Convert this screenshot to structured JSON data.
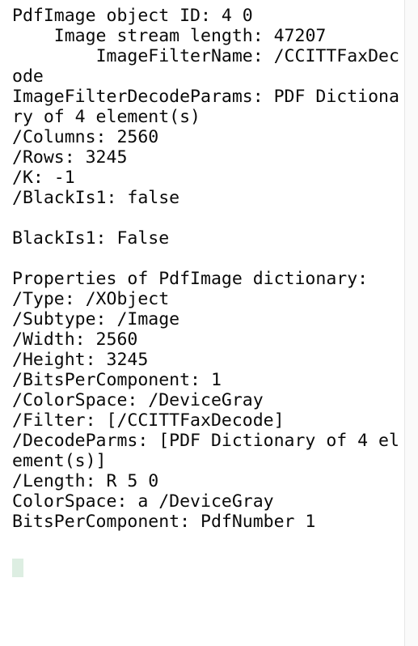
{
  "console": {
    "title": "PdfImage object inspection output",
    "background_color": "#ffffff",
    "text_color": "#0a0a0a",
    "cursor_color": "#ddeee2",
    "gutter_color": "#fafafa",
    "divider_color": "#e6e6e6",
    "font_size_px": 21.5,
    "line_height_px": 25,
    "wrap_columns": 36,
    "output": "PdfImage object ID: 4 0\n    Image stream length: 47207\n        ImageFilterName: /CCITTFaxDecode\nImageFilterDecodeParams: PDF Dictionary of 4 element(s)\n/Columns: 2560\n/Rows: 3245\n/K: -1\n/BlackIs1: false\n\nBlackIs1: False\n\nProperties of PdfImage dictionary:\n/Type: /XObject\n/Subtype: /Image\n/Width: 2560\n/Height: 3245\n/BitsPerComponent: 1\n/ColorSpace: /DeviceGray\n/Filter: [/CCITTFaxDecode]\n/DecodeParms: [PDF Dictionary of 4 element(s)]\n/Length: R 5 0\nColorSpace: a /DeviceGray\nBitsPerComponent: PdfNumber 1\n",
    "lines": [
      {
        "indent": 0,
        "text": "PdfImage object ID: 4 0"
      },
      {
        "indent": 4,
        "text": "Image stream length: 47207"
      },
      {
        "indent": 8,
        "text": "ImageFilterName: /CCITTFaxDecode"
      },
      {
        "indent": 0,
        "text": "ImageFilterDecodeParams: PDF Dictionary of 4 element(s)"
      },
      {
        "indent": 0,
        "text": "/Columns: 2560"
      },
      {
        "indent": 0,
        "text": "/Rows: 3245"
      },
      {
        "indent": 0,
        "text": "/K: -1"
      },
      {
        "indent": 0,
        "text": "/BlackIs1: false"
      },
      {
        "indent": 0,
        "text": ""
      },
      {
        "indent": 0,
        "text": "BlackIs1: False"
      },
      {
        "indent": 0,
        "text": ""
      },
      {
        "indent": 0,
        "text": "Properties of PdfImage dictionary:"
      },
      {
        "indent": 0,
        "text": "/Type: /XObject"
      },
      {
        "indent": 0,
        "text": "/Subtype: /Image"
      },
      {
        "indent": 0,
        "text": "/Width: 2560"
      },
      {
        "indent": 0,
        "text": "/Height: 3245"
      },
      {
        "indent": 0,
        "text": "/BitsPerComponent: 1"
      },
      {
        "indent": 0,
        "text": "/ColorSpace: /DeviceGray"
      },
      {
        "indent": 0,
        "text": "/Filter: [/CCITTFaxDecode]"
      },
      {
        "indent": 0,
        "text": "/DecodeParms: [PDF Dictionary of 4 element(s)]"
      },
      {
        "indent": 0,
        "text": "/Length: R 5 0"
      },
      {
        "indent": 0,
        "text": "ColorSpace: a /DeviceGray"
      },
      {
        "indent": 0,
        "text": "BitsPerComponent: PdfNumber 1"
      }
    ],
    "values": {
      "object_id": "4 0",
      "image_stream_length": "47207",
      "image_filter_name": "/CCITTFaxDecode",
      "image_filter_decode_params": "PDF Dictionary of 4 element(s)",
      "columns": "2560",
      "rows": "3245",
      "k": "-1",
      "black_is_1_param": "false",
      "black_is_1_property": "False",
      "type": "/XObject",
      "subtype": "/Image",
      "width": "2560",
      "height": "3245",
      "bits_per_component": "1",
      "color_space": "/DeviceGray",
      "filter": "[/CCITTFaxDecode]",
      "decode_parms": "[PDF Dictionary of 4 element(s)]",
      "length": "R 5 0",
      "color_space_resolved": "a /DeviceGray",
      "bits_per_component_resolved": "PdfNumber 1"
    }
  }
}
